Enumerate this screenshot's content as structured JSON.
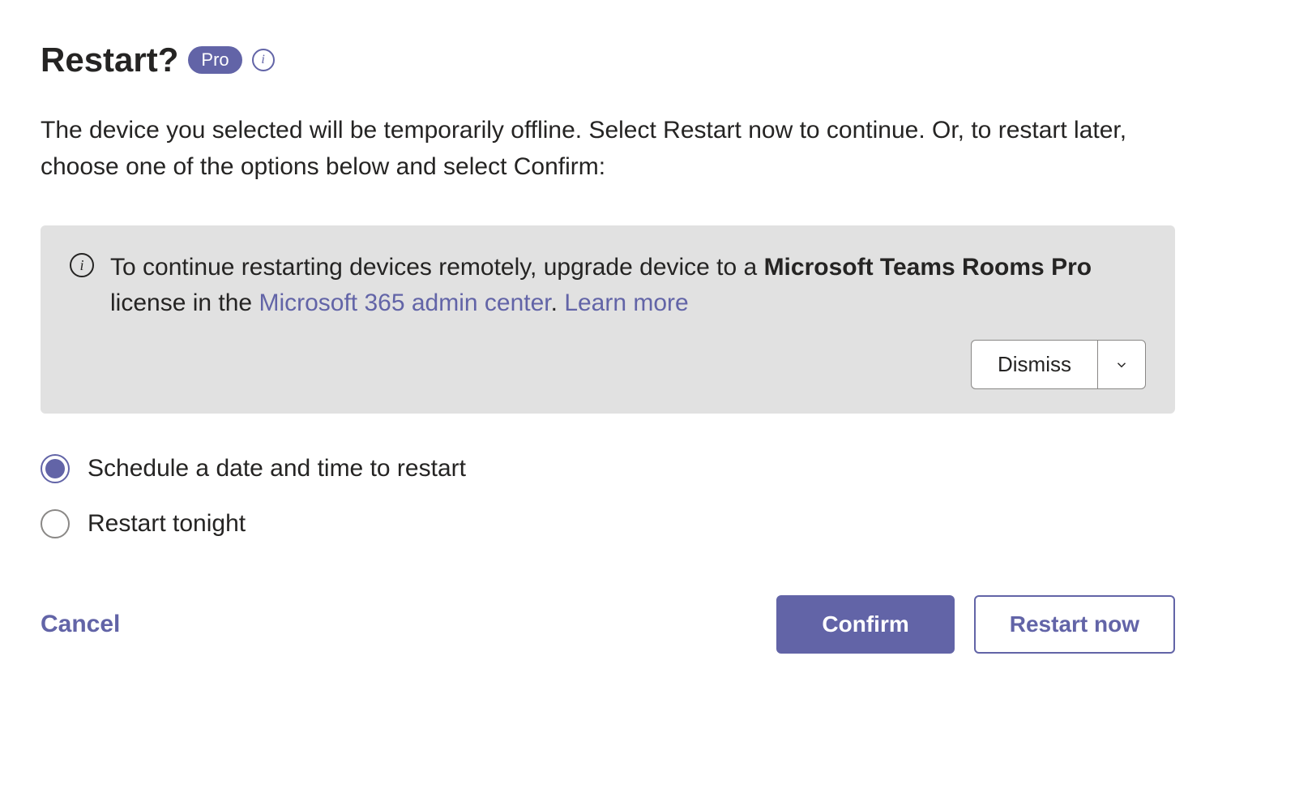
{
  "header": {
    "title": "Restart?",
    "badge": "Pro"
  },
  "description": "The device you selected will be temporarily offline. Select Restart now to continue. Or, to restart later, choose one of the options below and select Confirm:",
  "banner": {
    "text_prefix": "To continue restarting devices remotely, upgrade device to a ",
    "bold_text": "Microsoft Teams Rooms Pro",
    "text_mid": " license in the ",
    "link1": "Microsoft 365 admin center",
    "separator": ". ",
    "link2": "Learn more",
    "dismiss_label": "Dismiss"
  },
  "options": {
    "schedule": {
      "label": "Schedule a date and time to restart",
      "selected": true
    },
    "tonight": {
      "label": "Restart tonight",
      "selected": false
    }
  },
  "footer": {
    "cancel": "Cancel",
    "confirm": "Confirm",
    "restart_now": "Restart now"
  }
}
